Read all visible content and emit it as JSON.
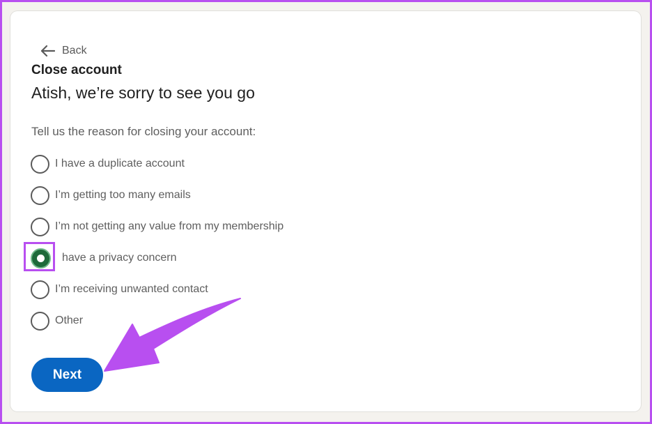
{
  "back_label": "Back",
  "title": "Close account",
  "subtitle": "Atish, we’re sorry to see you go",
  "prompt": "Tell us the reason for closing your account:",
  "options": [
    {
      "label": "I have a duplicate account",
      "selected": false
    },
    {
      "label": "I’m getting too many emails",
      "selected": false
    },
    {
      "label": "I’m not getting any value from my membership",
      "selected": false
    },
    {
      "label": "have a privacy concern",
      "selected": true
    },
    {
      "label": "I’m receiving unwanted contact",
      "selected": false
    },
    {
      "label": "Other",
      "selected": false
    }
  ],
  "next_label": "Next",
  "colors": {
    "primary_button": "#0a66c2",
    "selected_radio": "#1d6a3a",
    "annotation": "#b84ff0"
  },
  "icons": {
    "back": "arrow-left-icon",
    "annotation": "pointer-arrow-icon"
  }
}
